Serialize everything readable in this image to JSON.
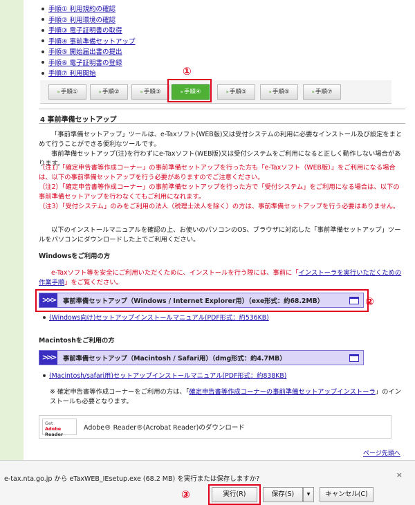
{
  "steps": [
    "手順① 利用規約の確認",
    "手順② 利用環境の確認",
    "手順③ 電子証明書の取得",
    "手順④ 事前準備セットアップ",
    "手順⑤ 開始届出書の提出",
    "手順⑥ 電子証明書の登録",
    "手順⑦ 利用開始"
  ],
  "markers": {
    "m1": "①",
    "m2": "②",
    "m3": "③"
  },
  "tabs": [
    "手順①",
    "手順②",
    "手順③",
    "手順④",
    "手順⑤",
    "手順⑥",
    "手順⑦"
  ],
  "tab_arrow": "»",
  "active_tab_index": 3,
  "section": {
    "heading": "4 事前準備セットアップ",
    "intro_1": "「事前準備セットアップ」ツールは、e-Taxソフト(WEB版)又は受付システムの利用に必要なインストール及び設定をまとめて行うことができる便利なツールです。",
    "intro_2": "事前準備セットアップ(注)を行わずにe-Taxソフト(WEB版)又は受付システムをご利用になると正しく動作しない場合があります。",
    "note_1": "（注1）「確定申告書等作成コーナー」の事前準備セットアップを行った方も「e-Taxソフト（WEB版）」をご利用になる場合は、以下の事前準備セットアップを行う必要がありますのでご注意ください。",
    "note_2": "（注2）「確定申告書等作成コーナー」の事前準備セットアップを行った方で「受付システム」をご利用になる場合は、以下の事前準備セットアップを行わなくてもご利用になれます。",
    "note_3": "（注3）「受付システム」のみをご利用の法人（税理士法人を除く）の方は、事前準備セットアップを行う必要はありません。",
    "instructions": "以下のインストールマニュアルを確認の上、お使いのパソコンのOS、ブラウザに対応した「事前準備セットアップ」ツールをパソコンにダウンロードした上でご利用ください。"
  },
  "windows": {
    "heading": "Windowsをご利用の方",
    "warn_pre": "e-Taxソフト等を安全にご利用いただくために、インストールを行う際には、事前に「",
    "warn_link": "インストーラを実行いただくための作業手順",
    "warn_post": "」をご覧ください。",
    "download_label": "事前準備セットアップ（Windows / Internet Explorer用）（exe形式：約68.2MB）",
    "manual_link": "(Windows向け)セットアップインストールマニュアル(PDF形式：約536KB)"
  },
  "mac": {
    "heading": "Macintoshをご利用の方",
    "download_label": "事前準備セットアップ（Macintosh / Safari用）（dmg形式：約4.7MB）",
    "manual_link": "(Macintosh/safari用)セットアップインストールマニュアル(PDF形式：約838KB)",
    "note_pre": "※ 確定申告書等作成コーナーをご利用の方は、「",
    "note_link": "確定申告書等作成コーナーの事前準備セットアップインストーラ",
    "note_post": "」のインストールも必要となります。"
  },
  "adobe": {
    "badge_get": "Get",
    "badge_adobe": "Adobe",
    "badge_reader": "Reader",
    "text": "Adobe® Reader®(Acrobat Reader)のダウンロード"
  },
  "page_top": "ページ先頭へ",
  "download_bar": {
    "message": "e-tax.nta.go.jp から eTaxWEB_IEsetup.exe (68.2 MB) を実行または保存しますか?",
    "run": "実行(R)",
    "save": "保存(S)",
    "save_dropdown": "▾",
    "cancel": "キャンセル(C)",
    "close": "×"
  }
}
